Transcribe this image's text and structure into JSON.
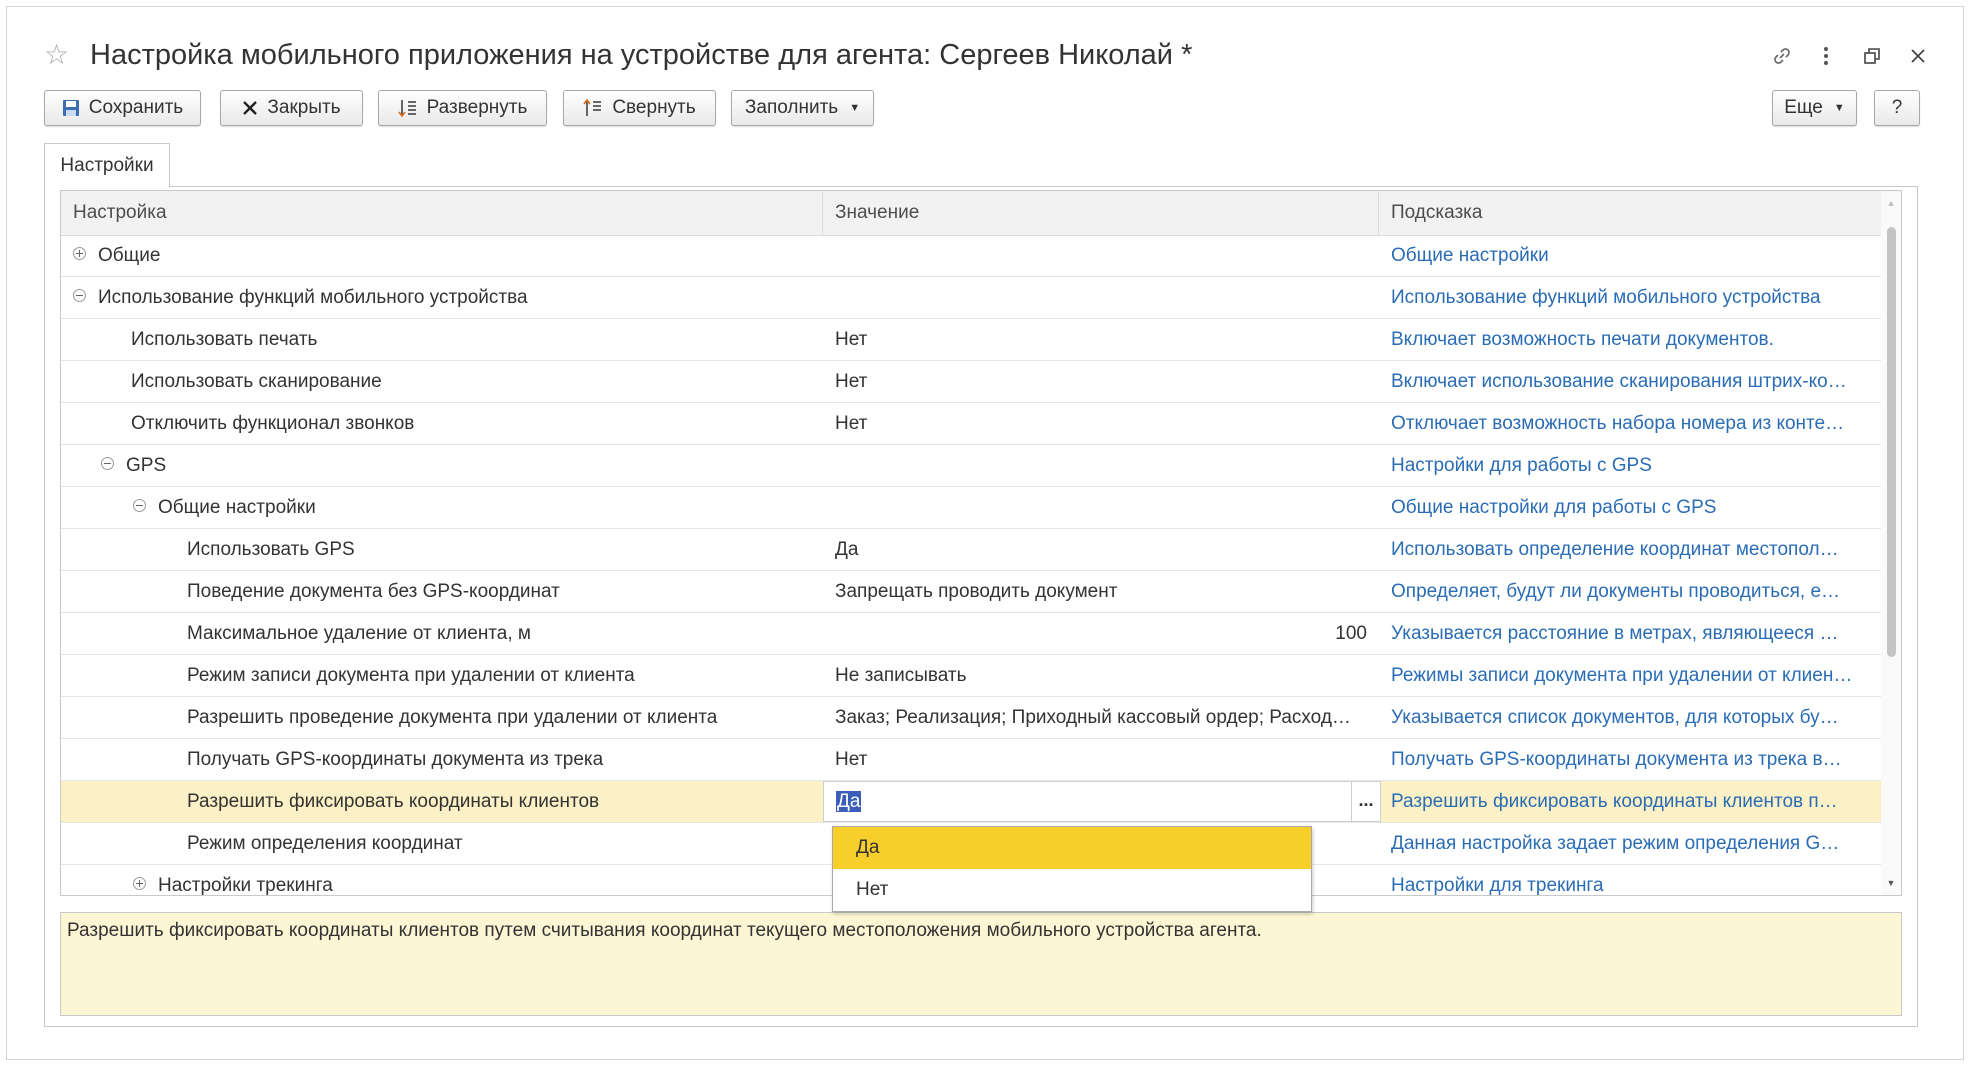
{
  "window": {
    "title": "Настройка мобильного приложения на устройстве для агента: Сергеев Николай *"
  },
  "toolbar": {
    "save": "Сохранить",
    "close": "Закрыть",
    "expand": "Развернуть",
    "collapse": "Свернуть",
    "fill": "Заполнить",
    "more": "Еще",
    "help": "?"
  },
  "tabs": {
    "settings": "Настройки"
  },
  "grid": {
    "columns": [
      "Настройка",
      "Значение",
      "Подсказка"
    ],
    "rows": [
      {
        "name": "Общие",
        "value": "",
        "hint": "Общие настройки",
        "level": 0,
        "toggle": "plus"
      },
      {
        "name": "Использование функций мобильного устройства",
        "value": "",
        "hint": "Использование функций мобильного устройства",
        "level": 0,
        "toggle": "minus"
      },
      {
        "name": "Использовать печать",
        "value": "Нет",
        "hint": "Включает возможность печати документов.",
        "level": 1,
        "toggle": ""
      },
      {
        "name": "Использовать сканирование",
        "value": "Нет",
        "hint": "Включает использование сканирования штрих-ко…",
        "level": 1,
        "toggle": ""
      },
      {
        "name": "Отключить функционал звонков",
        "value": "Нет",
        "hint": "Отключает возможность набора номера из конте…",
        "level": 1,
        "toggle": ""
      },
      {
        "name": "GPS",
        "value": "",
        "hint": "Настройки для работы с GPS",
        "level": 1,
        "toggle": "minus"
      },
      {
        "name": "Общие настройки",
        "value": "",
        "hint": "Общие настройки для работы с GPS",
        "level": 2,
        "toggle": "minus"
      },
      {
        "name": "Использовать GPS",
        "value": "Да",
        "hint": "Использовать определение координат местопол…",
        "level": 3,
        "toggle": ""
      },
      {
        "name": "Поведение документа без GPS-координат",
        "value": "Запрещать проводить документ",
        "hint": "Определяет, будут ли документы проводиться, е…",
        "level": 3,
        "toggle": ""
      },
      {
        "name": "Максимальное удаление от клиента, м",
        "value": "100",
        "hint": "Указывается расстояние в метрах, являющееся …",
        "level": 3,
        "toggle": "",
        "numeric": true
      },
      {
        "name": "Режим записи документа при удалении от клиента",
        "value": "Не записывать",
        "hint": "Режимы записи документа при удалении от клиен…",
        "level": 3,
        "toggle": ""
      },
      {
        "name": "Разрешить проведение документа при удалении от клиента",
        "value": "Заказ; Реализация; Приходный кассовый ордер; Расход…",
        "hint": "Указывается список документов, для которых бу…",
        "level": 3,
        "toggle": ""
      },
      {
        "name": "Получать GPS-координаты документа из трека",
        "value": "Нет",
        "hint": "Получать GPS-координаты документа из трека в…",
        "level": 3,
        "toggle": ""
      },
      {
        "name": "Разрешить фиксировать координаты клиентов",
        "value": "Да",
        "hint": "Разрешить фиксировать координаты клиентов п…",
        "level": 3,
        "toggle": "",
        "selected": true
      },
      {
        "name": "Режим определения координат",
        "value": "",
        "hint": "Данная настройка задает режим определения G…",
        "level": 3,
        "toggle": ""
      },
      {
        "name": "Настройки трекинга",
        "value": "",
        "hint": "Настройки для трекинга",
        "level": 2,
        "toggle": "plus"
      }
    ]
  },
  "dropdown": {
    "options": [
      "Да",
      "Нет"
    ],
    "active_index": 0
  },
  "hint_panel": {
    "text": "Разрешить фиксировать координаты клиентов путем считывания координат текущего местоположения мобильного устройства агента."
  },
  "colors": {
    "link": "#2a6cb5",
    "selected_row": "#fbf0c6",
    "dropdown_active": "#f8cf2a",
    "hint_bg": "#fdf6d4"
  }
}
